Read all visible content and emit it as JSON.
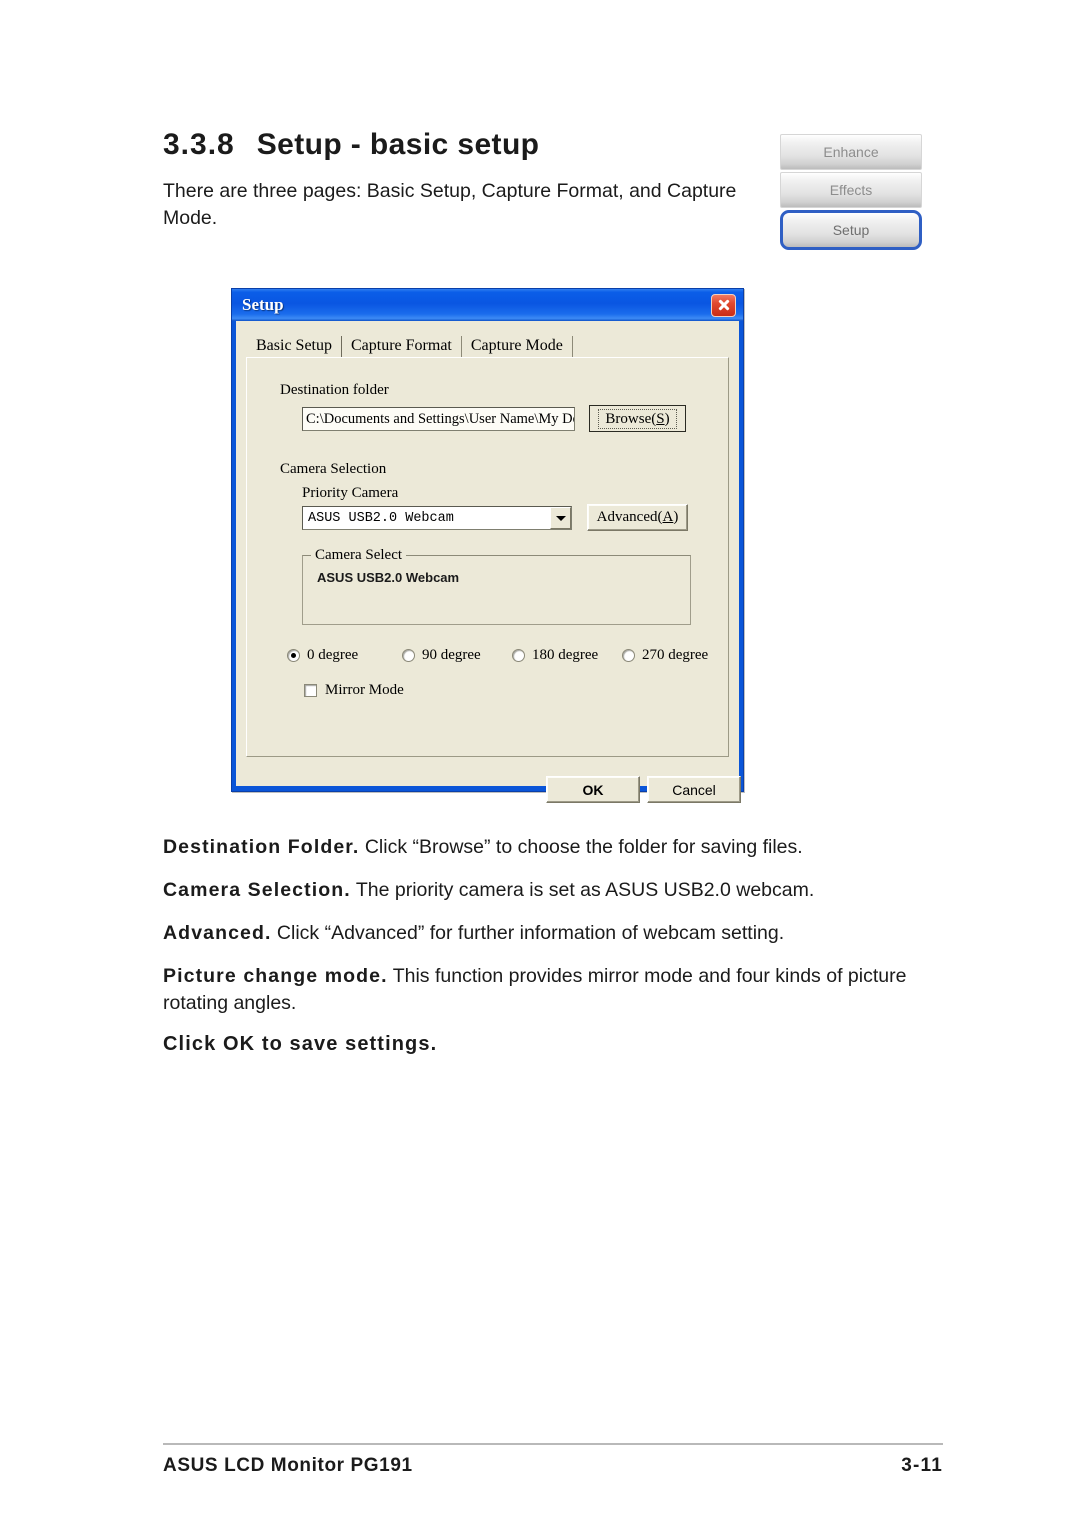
{
  "page": {
    "section_number": "3.3.8",
    "section_title": "Setup - basic setup",
    "intro": "There are three pages: Basic Setup, Capture Format, and Capture Mode."
  },
  "side_buttons": {
    "items": [
      {
        "label": "Enhance",
        "selected": false
      },
      {
        "label": "Effects",
        "selected": false
      },
      {
        "label": "Setup",
        "selected": true
      }
    ],
    "selected_border_color": "#2f5fc4"
  },
  "dialog": {
    "title": "Setup",
    "close_icon": "close-icon",
    "titlebar_color": "#0a56e2",
    "body_color": "#ece9d8",
    "tabs": [
      {
        "label": "Basic Setup",
        "active": true
      },
      {
        "label": "Capture Format",
        "active": false
      },
      {
        "label": "Capture Mode",
        "active": false
      }
    ],
    "destination": {
      "label": "Destination folder",
      "path_value": "C:\\Documents and Settings\\User Name\\My Docur",
      "browse_label": "Browse(",
      "browse_accel": "S",
      "browse_label_end": ")"
    },
    "camera_selection": {
      "label": "Camera Selection",
      "priority_label": "Priority Camera",
      "priority_value": "ASUS USB2.0 Webcam",
      "advanced_label": "Advanced(",
      "advanced_accel": "A",
      "advanced_label_end": ")",
      "group_title": "Camera Select",
      "group_items": [
        "ASUS USB2.0 Webcam"
      ]
    },
    "rotation": {
      "options": [
        {
          "label": "0 degree",
          "checked": true
        },
        {
          "label": "90 degree",
          "checked": false
        },
        {
          "label": "180 degree",
          "checked": false
        },
        {
          "label": "270 degree",
          "checked": false
        }
      ]
    },
    "mirror_mode": {
      "label": "Mirror Mode",
      "checked": false
    },
    "buttons": {
      "ok": "OK",
      "cancel": "Cancel"
    }
  },
  "descriptions": [
    {
      "term": "Destination Folder.",
      "text": " Click “Browse” to choose the folder for saving files."
    },
    {
      "term": "Camera Selection.",
      "text": " The priority camera is set as ASUS USB2.0 webcam."
    },
    {
      "term": "Advanced.",
      "text": " Click “Advanced” for further information of webcam setting."
    },
    {
      "term": "Picture change mode.",
      "text": " This function provides mirror mode and four kinds of picture rotating angles."
    }
  ],
  "closing_line": "Click OK to save settings.",
  "footer": {
    "left": "ASUS LCD Monitor PG191",
    "page_number": "3-11"
  }
}
